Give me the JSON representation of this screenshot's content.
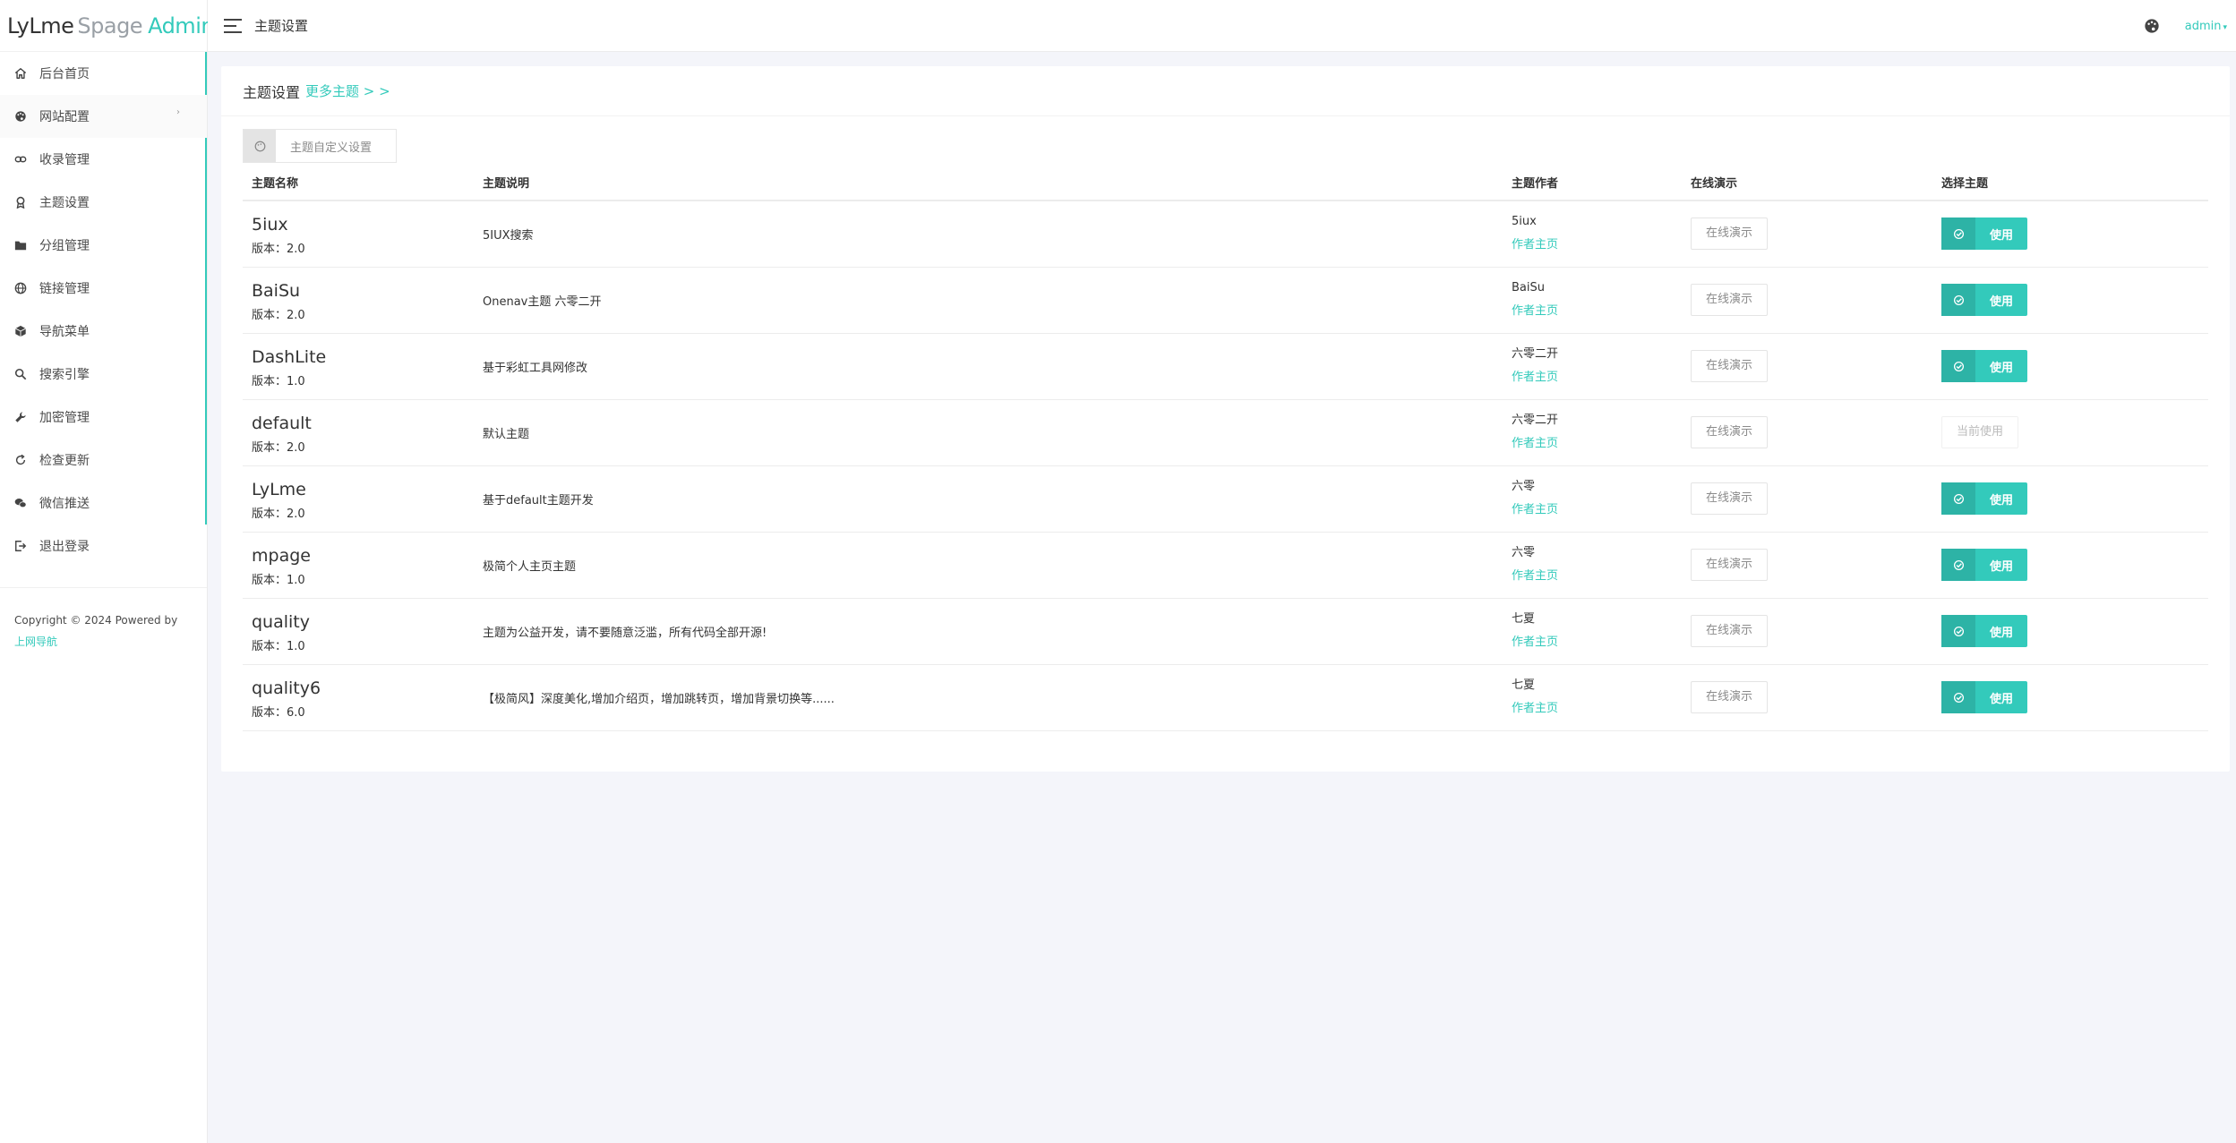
{
  "brand": {
    "part1": "LyLme",
    "part2": "Spage",
    "part3": "Admin"
  },
  "header": {
    "title": "主题设置",
    "user": "admin"
  },
  "sidebar": {
    "items": [
      {
        "label": "后台首页",
        "icon": "home-icon"
      },
      {
        "label": "网站配置",
        "icon": "palette-icon"
      },
      {
        "label": "收录管理",
        "icon": "link-icon"
      },
      {
        "label": "主题设置",
        "icon": "award-icon"
      },
      {
        "label": "分组管理",
        "icon": "folder-icon"
      },
      {
        "label": "链接管理",
        "icon": "globe-icon"
      },
      {
        "label": "导航菜单",
        "icon": "box-icon"
      },
      {
        "label": "搜索引擎",
        "icon": "search-icon"
      },
      {
        "label": "加密管理",
        "icon": "wrench-icon"
      },
      {
        "label": "检查更新",
        "icon": "refresh-icon"
      },
      {
        "label": "微信推送",
        "icon": "wechat-icon"
      },
      {
        "label": "退出登录",
        "icon": "logout-icon"
      }
    ],
    "copyright": "Copyright © 2024 Powered by",
    "copyright_link": "上网导航"
  },
  "card": {
    "title": "主题设置",
    "more_link": "更多主题 > >",
    "custom_button": "主题自定义设置",
    "columns": [
      "主题名称",
      "主题说明",
      "主题作者",
      "在线演示",
      "选择主题"
    ],
    "version_prefix": "版本：",
    "author_link": "作者主页",
    "demo_label": "在线演示",
    "use_label": "使用",
    "current_label": "当前使用"
  },
  "themes": [
    {
      "name": "5iux",
      "version": "2.0",
      "desc": "5IUX搜索",
      "author": "5iux",
      "current": false
    },
    {
      "name": "BaiSu",
      "version": "2.0",
      "desc": "Onenav主题 六零二开",
      "author": "BaiSu",
      "current": false
    },
    {
      "name": "DashLite",
      "version": "1.0",
      "desc": "基于彩虹工具网修改",
      "author": "六零二开",
      "current": false
    },
    {
      "name": "default",
      "version": "2.0",
      "desc": "默认主题",
      "author": "六零二开",
      "current": true
    },
    {
      "name": "LyLme",
      "version": "2.0",
      "desc": "基于default主题开发",
      "author": "六零",
      "current": false
    },
    {
      "name": "mpage",
      "version": "1.0",
      "desc": "极简个人主页主题",
      "author": "六零",
      "current": false
    },
    {
      "name": "quality",
      "version": "1.0",
      "desc": "主题为公益开发，请不要随意泛滥，所有代码全部开源!",
      "author": "七夏",
      "current": false
    },
    {
      "name": "quality6",
      "version": "6.0",
      "desc": "【极简风】深度美化,增加介绍页，增加跳转页，增加背景切换等......",
      "author": "七夏",
      "current": false
    }
  ],
  "colors": {
    "accent": "#33cabb",
    "background": "#f4f5fa"
  }
}
